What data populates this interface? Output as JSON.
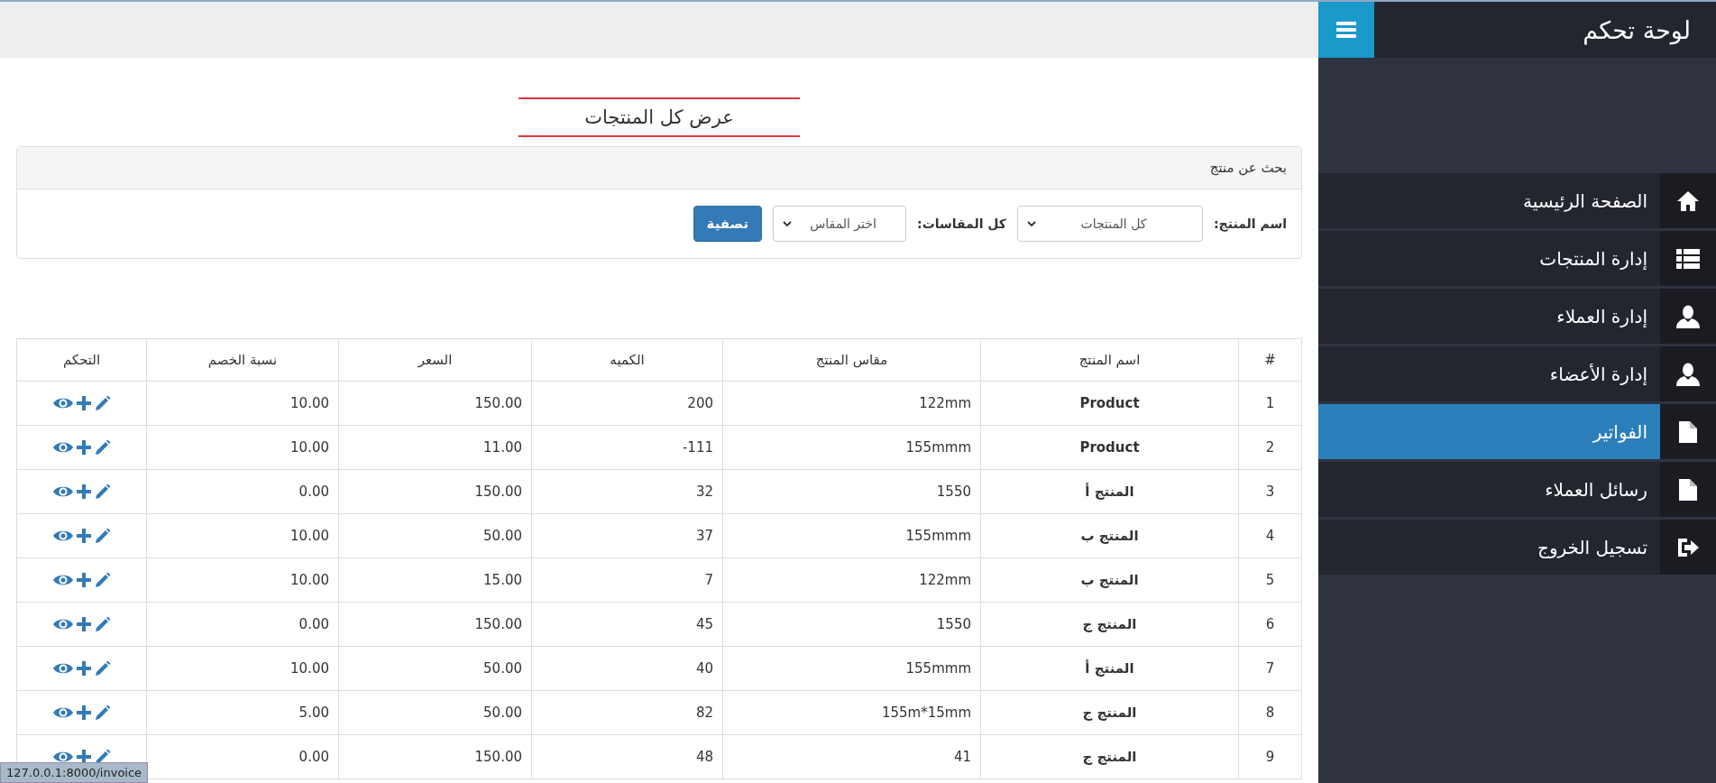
{
  "sidebar": {
    "title": "لوحة تحكم",
    "items": [
      {
        "label": "الصفحة الرئيسية",
        "kind": "home",
        "selected": false
      },
      {
        "label": "إدارة المنتجات",
        "kind": "list",
        "selected": false
      },
      {
        "label": "إدارة العملاء",
        "kind": "user",
        "selected": false
      },
      {
        "label": "إدارة الأعضاء",
        "kind": "user",
        "selected": false
      },
      {
        "label": "الفواتير",
        "kind": "file",
        "selected": true
      },
      {
        "label": "رسائل العملاء",
        "kind": "file",
        "selected": false
      },
      {
        "label": "تسجيل الخروج",
        "kind": "logout",
        "selected": false
      }
    ]
  },
  "page_title": "عرض كل المنتجات",
  "search_panel": {
    "heading": "بحث عن منتج",
    "product_label": "اسم المنتج:",
    "product_select": "كل المنتجات",
    "size_label": "كل المقاسات:",
    "size_select": "اختر المقاس",
    "filter_button": "تصفية"
  },
  "table": {
    "columns": [
      "#",
      "اسم المنتج",
      "مقاس المنتج",
      "الكميه",
      "السعر",
      "نسبة الخصم",
      "التحكم"
    ],
    "rows": [
      {
        "num": "1",
        "name": "Product",
        "size": "122mm",
        "qty": "200",
        "price": "150.00",
        "discount": "10.00"
      },
      {
        "num": "2",
        "name": "Product",
        "size": "155mmm",
        "qty": "111-",
        "price": "11.00",
        "discount": "10.00"
      },
      {
        "num": "3",
        "name": "المنتج أ",
        "size": "1550",
        "qty": "32",
        "price": "150.00",
        "discount": "0.00"
      },
      {
        "num": "4",
        "name": "المنتج ب",
        "size": "155mmm",
        "qty": "37",
        "price": "50.00",
        "discount": "10.00"
      },
      {
        "num": "5",
        "name": "المنتج ب",
        "size": "122mm",
        "qty": "7",
        "price": "15.00",
        "discount": "10.00"
      },
      {
        "num": "6",
        "name": "المنتج ج",
        "size": "1550",
        "qty": "45",
        "price": "150.00",
        "discount": "0.00"
      },
      {
        "num": "7",
        "name": "المنتج أ",
        "size": "155mmm",
        "qty": "40",
        "price": "50.00",
        "discount": "10.00"
      },
      {
        "num": "8",
        "name": "المنتج ج",
        "size": "155m*15mm",
        "qty": "82",
        "price": "50.00",
        "discount": "5.00"
      },
      {
        "num": "9",
        "name": "المنتج ج",
        "size": "41",
        "qty": "48",
        "price": "150.00",
        "discount": "0.00"
      }
    ]
  },
  "status_bar": "127.0.0.1:8000/invoice"
}
